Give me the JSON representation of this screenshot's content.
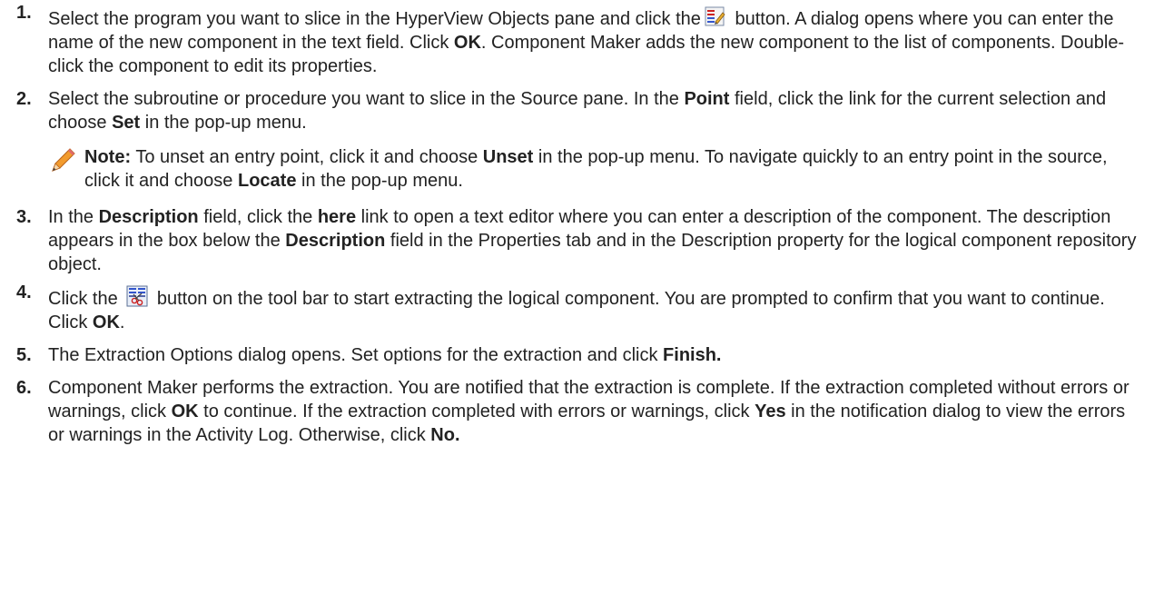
{
  "steps": [
    {
      "num": "1.",
      "t1": "Select the program you want to slice in the HyperView Objects pane and click the",
      "icon": "new-component-icon",
      "t2": "button. A dialog opens where you can enter the name of the new component in the text field. Click",
      "b1": "OK",
      "t3": ". Component Maker adds the new component to the list of components. Double-click the component to edit its properties."
    },
    {
      "num": "2.",
      "t1": "Select the subroutine or procedure you want to slice in the Source pane. In the",
      "b1": "Point",
      "t2": "field, click the link for the current selection and choose",
      "b2": "Set",
      "t3": "in the pop-up menu."
    },
    {
      "num": "3.",
      "t1": "In the",
      "b1": "Description",
      "t2": "field, click the",
      "b2": "here",
      "t3": "link to open a text editor where you can enter a description of the component. The description appears in the box below the",
      "b3": "Description",
      "t4": "field in the Properties tab and in the Description property for the logical component repository object."
    },
    {
      "num": "4.",
      "t1": "Click the",
      "icon": "extract-component-icon",
      "t2": "button on the tool bar to start extracting the logical component. You are prompted to confirm that you want to continue. Click",
      "b1": "OK",
      "t3": "."
    },
    {
      "num": "5.",
      "t1": "The Extraction Options dialog opens. Set options for the extraction and click",
      "b1": "Finish."
    },
    {
      "num": "6.",
      "t1": "Component Maker performs the extraction. You are notified that the extraction is complete. If the extraction completed without errors or warnings, click",
      "b1": "OK",
      "t2": "to continue. If the extraction completed with errors or warnings, click",
      "b2": "Yes",
      "t3": "in the notification dialog to view the errors or warnings in the Activity Log. Otherwise, click",
      "b3": "No."
    }
  ],
  "note": {
    "icon": "pencil-icon",
    "label": "Note:",
    "t1": "To unset an entry point, click it and choose",
    "b1": "Unset",
    "t2": "in the pop-up menu. To navigate quickly to an entry point in the source, click it and choose",
    "b2": "Locate",
    "t3": "in the pop-up menu."
  }
}
